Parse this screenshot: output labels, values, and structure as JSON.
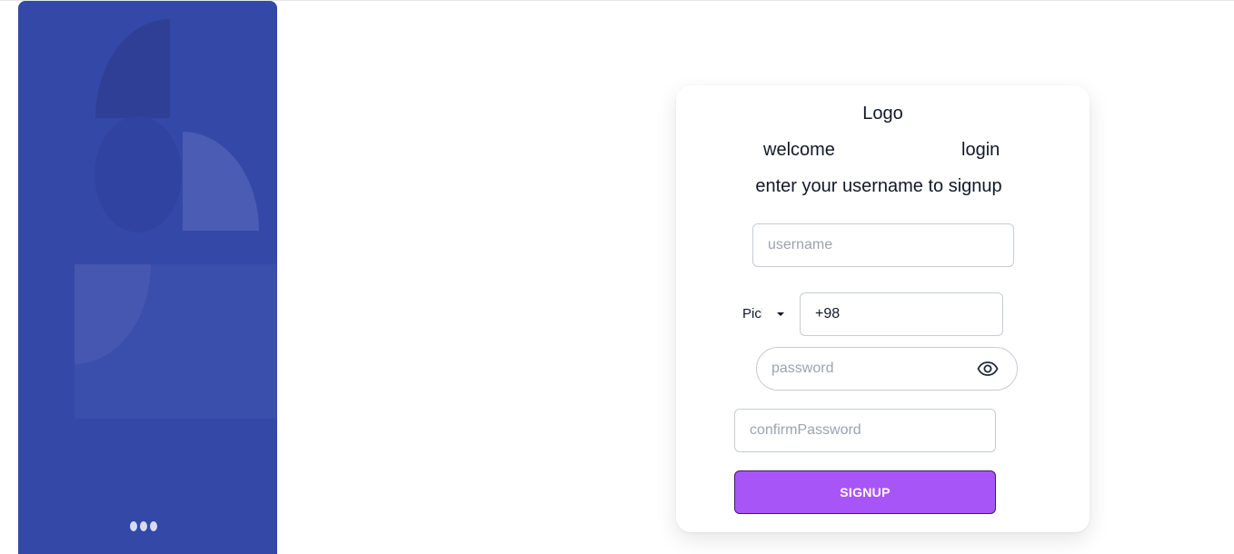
{
  "hero": {
    "icon": "abstract-geometric-illustration",
    "carousel_dots": 3,
    "background_color": "#3448a8"
  },
  "form": {
    "logo": "Logo",
    "welcome": "welcome",
    "login_link": "login",
    "subtitle": "enter your username to signup",
    "username_placeholder": "username",
    "country_picker_label": "Pick",
    "phone_value": "+98",
    "password_placeholder": "password",
    "confirm_password_placeholder": "confirmPassword",
    "signup_label": "SIGNUP",
    "eye_icon": "eye-icon",
    "accent_color": "#a855f7"
  }
}
